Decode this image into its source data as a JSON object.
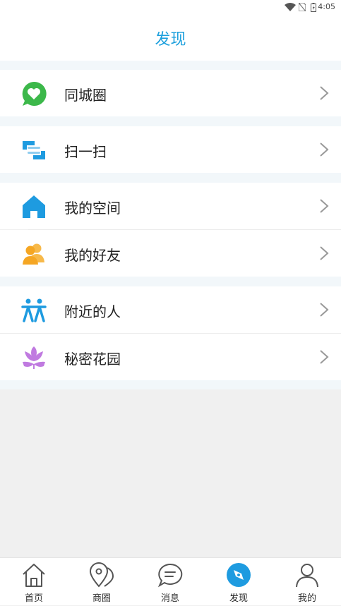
{
  "status_bar": {
    "time": "4:05"
  },
  "header": {
    "title": "发现"
  },
  "menu": {
    "city_circle": "同城圈",
    "scan": "扫一扫",
    "my_space": "我的空间",
    "my_friends": "我的好友",
    "nearby_people": "附近的人",
    "secret_garden": "秘密花园"
  },
  "tabs": {
    "home": "首页",
    "business": "商圈",
    "messages": "消息",
    "discover": "发现",
    "mine": "我的"
  },
  "colors": {
    "accent": "#1ea0dd",
    "city_circle_icon": "#3cb84a",
    "scan_icon": "#1e9be0",
    "space_icon": "#1e9be0",
    "friends_icon": "#f5a623",
    "nearby_icon": "#1e9be0",
    "garden_icon": "#c07ae0"
  }
}
